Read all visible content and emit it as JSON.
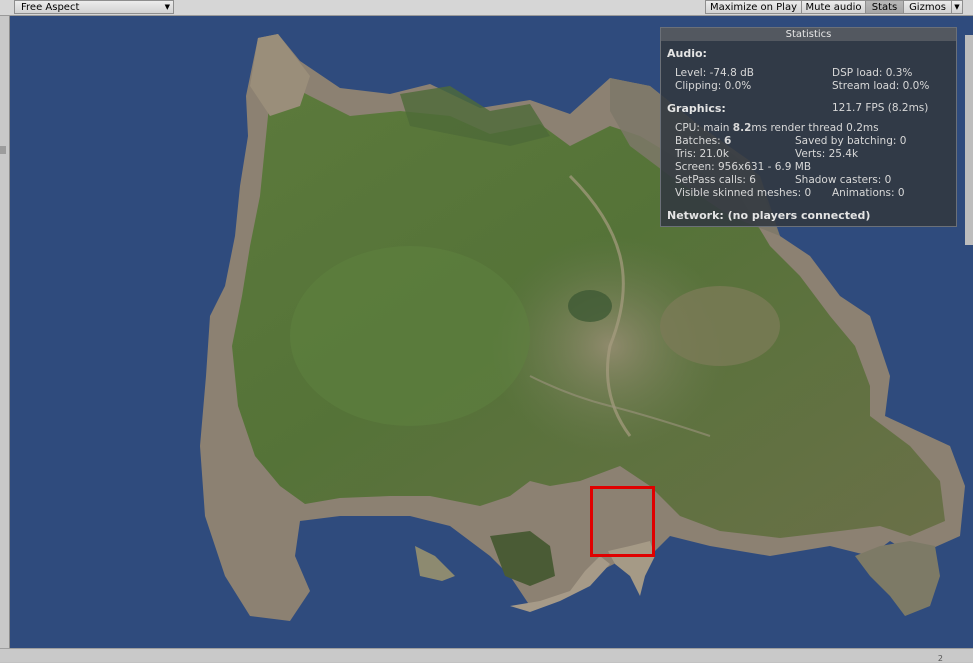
{
  "toolbar": {
    "aspect_label": "Free Aspect",
    "buttons": [
      {
        "label": "Maximize on Play",
        "active": false
      },
      {
        "label": "Mute audio",
        "active": false
      },
      {
        "label": "Stats",
        "active": true
      },
      {
        "label": "Gizmos",
        "active": false
      }
    ]
  },
  "stats": {
    "title": "Statistics",
    "audio_header": "Audio:",
    "level": "Level: -74.8 dB",
    "dsp_load": "DSP load: 0.3%",
    "clipping": "Clipping: 0.0%",
    "stream_load": "Stream load: 0.0%",
    "graphics_header": "Graphics:",
    "fps": "121.7 FPS (8.2ms)",
    "cpu_prefix": "CPU: main ",
    "cpu_main": "8.2",
    "cpu_suffix": "ms  render thread 0.2ms",
    "batches_prefix": "Batches: ",
    "batches": "6",
    "saved_by_batching": "Saved by batching: 0",
    "tris": "Tris: 21.0k",
    "verts": "Verts: 25.4k",
    "screen": "Screen: 956x631 - 6.9 MB",
    "setpass": "SetPass calls: 6",
    "shadow_casters": "Shadow casters: 0",
    "skinned": "Visible skinned meshes: 0",
    "animations": "Animations: 0",
    "network": "Network: (no players connected)"
  },
  "colors": {
    "sky": "#2f4b7d",
    "highlight_box": "#e00000"
  },
  "bottom_counter": "2"
}
